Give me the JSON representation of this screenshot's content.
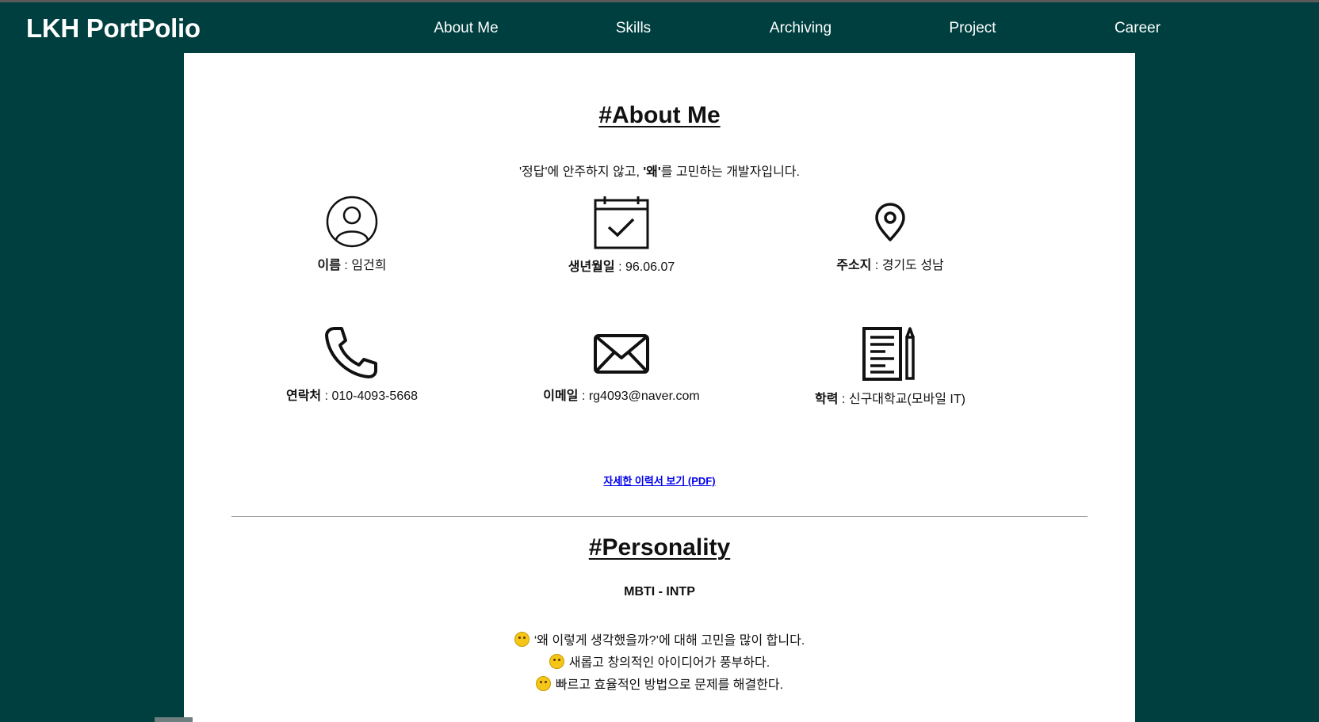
{
  "brand": "LKH PortPolio",
  "nav": [
    {
      "label": "About Me"
    },
    {
      "label": "Skills"
    },
    {
      "label": "Archiving"
    },
    {
      "label": "Project"
    },
    {
      "label": "Career"
    }
  ],
  "about": {
    "title": "#About Me",
    "tagline_prefix": "'정답'에 안주하지 않고, ",
    "tagline_bold": "'왜'",
    "tagline_suffix": "를 고민하는 개발자입니다.",
    "items": [
      {
        "icon": "person-icon",
        "label": "이름",
        "sep": " : ",
        "value": "임건희"
      },
      {
        "icon": "calendar-check-icon",
        "label": "생년월일",
        "sep": " : ",
        "value": "96.06.07"
      },
      {
        "icon": "location-pin-icon",
        "label": "주소지",
        "sep": " : ",
        "value": "경기도 성남"
      },
      {
        "icon": "phone-icon",
        "label": "연락처",
        "sep": " : ",
        "value": "010-4093-5668"
      },
      {
        "icon": "mail-icon",
        "label": "이메일",
        "sep": " : ",
        "value": "rg4093@naver.com"
      },
      {
        "icon": "document-pencil-icon",
        "label": "학력",
        "sep": " : ",
        "value": "신구대학교(모바일 IT)"
      }
    ],
    "resume_link": "자세한 이력서 보기 (PDF)"
  },
  "personality": {
    "title": "#Personality",
    "mbti": "MBTI - INTP",
    "traits": [
      {
        "emoji": "thinking-face-icon",
        "text": "‘왜 이렇게 생각했을까?’에 대해 고민을 많이 합니다."
      },
      {
        "emoji": "monocle-face-icon",
        "text": "새롭고 창의적인 아이디어가 풍부하다."
      },
      {
        "emoji": "emoji-icon",
        "text": "빠르고 효율적인 방법으로 문제를 해결한다."
      }
    ]
  }
}
